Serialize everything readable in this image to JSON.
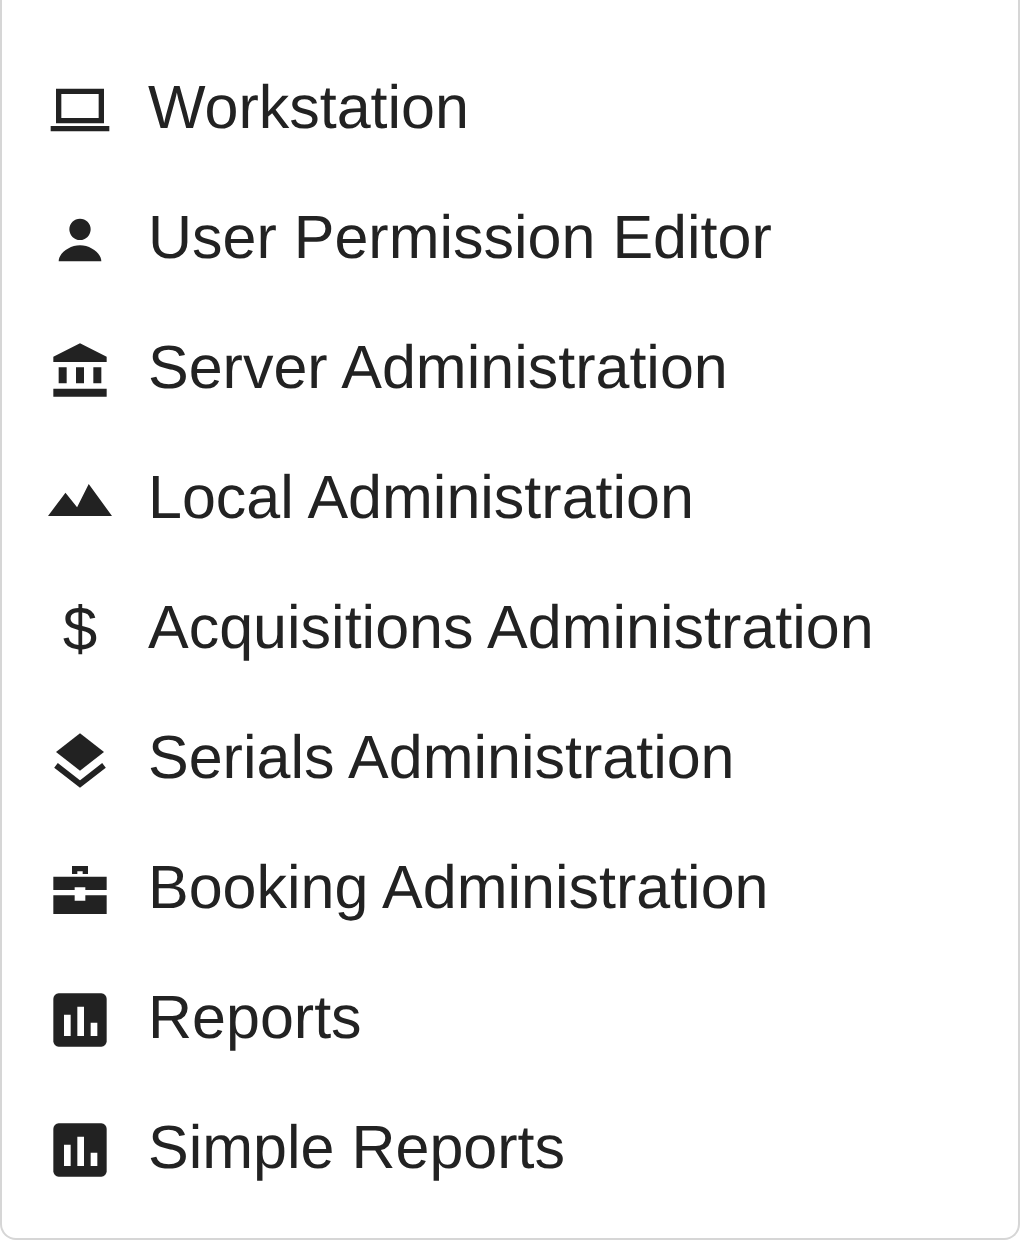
{
  "menu": {
    "items": [
      {
        "label": "Workstation",
        "kind": "laptop"
      },
      {
        "label": "User Permission Editor",
        "kind": "person"
      },
      {
        "label": "Server Administration",
        "kind": "bank"
      },
      {
        "label": "Local Administration",
        "kind": "terrain"
      },
      {
        "label": "Acquisitions Administration",
        "kind": "glyph",
        "glyph": "$"
      },
      {
        "label": "Serials Administration",
        "kind": "layers"
      },
      {
        "label": "Booking Administration",
        "kind": "briefcase"
      },
      {
        "label": "Reports",
        "kind": "chart"
      },
      {
        "label": "Simple Reports",
        "kind": "chart"
      }
    ]
  }
}
